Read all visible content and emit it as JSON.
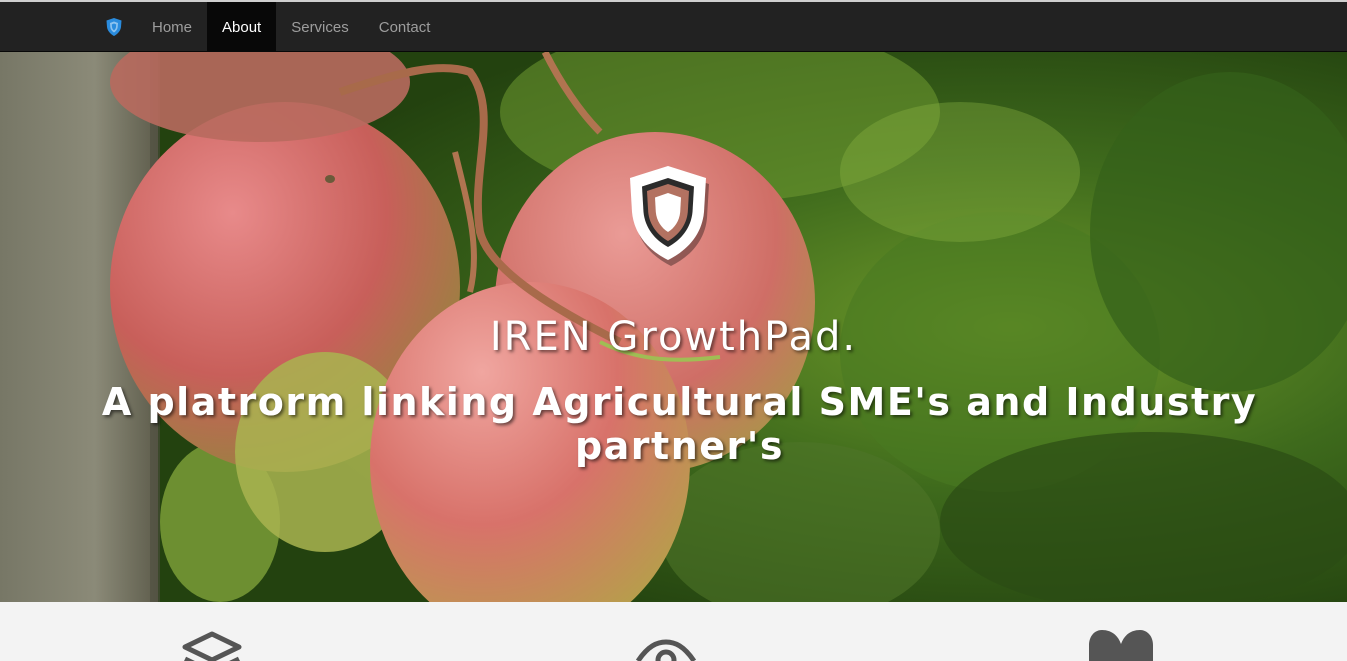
{
  "navbar": {
    "brand_icon": "shield-icon",
    "items": [
      {
        "label": "Home",
        "active": false
      },
      {
        "label": "About",
        "active": true
      },
      {
        "label": "Services",
        "active": false
      },
      {
        "label": "Contact",
        "active": false
      }
    ]
  },
  "hero": {
    "logo_icon": "shield-icon",
    "title": "IREN GrowthPad.",
    "subtitle": "A platrorm linking Agricultural SME's and Industry partner's",
    "background_image": "mango-tree-photo"
  },
  "features": {
    "icons": [
      "layers-icon",
      "eye-icon",
      "heart-icon"
    ]
  },
  "colors": {
    "navbar_bg": "#222222",
    "nav_active_bg": "#080808",
    "nav_text": "#9d9d9d",
    "nav_active_text": "#ffffff",
    "brand_icon": "#2a8cde",
    "features_bg": "#f3f3f3",
    "feature_icon": "#555555"
  }
}
